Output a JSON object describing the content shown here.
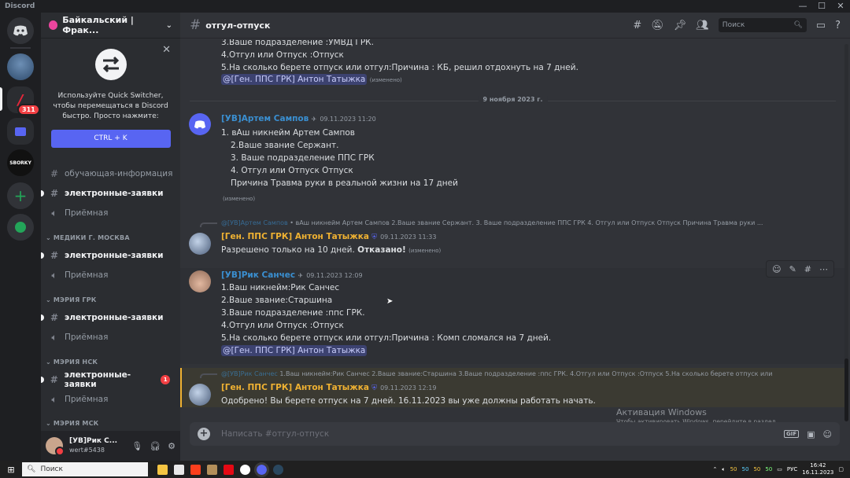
{
  "window": {
    "title": "Discord"
  },
  "server_badge_count": "311",
  "guild": {
    "name": "Байкальский | Фрак..."
  },
  "quick_switcher": {
    "text": "Используйте Quick Switcher, чтобы перемещаться в Discord быстро. Просто нажмите:",
    "shortcut": "CTRL + K"
  },
  "sidebar": {
    "channels": [
      {
        "name": "обучающая-информация",
        "type": "text"
      },
      {
        "name": "электронные-заявки",
        "type": "text"
      },
      {
        "name": "Приёмная",
        "type": "voice"
      }
    ],
    "categories": [
      {
        "name": "МЕДИКИ Г. МОСКВА",
        "channels": [
          {
            "name": "электронные-заявки"
          },
          {
            "name": "Приёмная"
          }
        ]
      },
      {
        "name": "МЭРИЯ ГРК",
        "channels": [
          {
            "name": "электронные-заявки"
          },
          {
            "name": "Приёмная"
          }
        ]
      },
      {
        "name": "МЭРИЯ НСК",
        "channels": [
          {
            "name": "электронные-заявки",
            "badge": "1"
          },
          {
            "name": "Приёмная"
          }
        ]
      },
      {
        "name": "МЭРИЯ МСК"
      }
    ]
  },
  "user": {
    "name": "[УВ]Рик С...",
    "tag": "wert#5438"
  },
  "channel": {
    "name": "отгул-отпуск"
  },
  "search": {
    "placeholder": "Поиск"
  },
  "messages": {
    "top_lines": [
      "3.Ваше подразделение :УМВД ГРК.",
      "4.Отгул или Отпуск :Отпуск",
      "5.На сколько берете отпуск или отгул:Причина :  КБ, решил отдохнуть на 7 дней."
    ],
    "top_mention": "@[Ген. ППС ГРК] Антон Татыжка",
    "edited": "(изменено)",
    "date_divider": "9 ноября 2023 г.",
    "m1": {
      "author": "[УВ]Артем Сампов",
      "time": "09.11.2023 11:20",
      "lines": [
        "1. вАш никнейм Артем Сампов",
        "   2.Ваше звание Сержант.",
        "   3. Ваше подразделение ППС ГРК",
        "   4. Отгул или Отпуск Отпуск",
        "   Причина Травма руки в реальной жизни на  17 дней"
      ]
    },
    "m2": {
      "reply_author": "@[УВ]Артем Сампов",
      "reply_text": "• вАш никнейм Артем Сампов 2.Ваше звание Сержант. 3. Ваше подразделение ППС ГРК 4. Отгул или Отпуск Отпуск Причина Травма руки ...",
      "author": "[Ген. ППС ГРК] Антон Татыжка",
      "time": "09.11.2023 11:33",
      "text": "Разрешено только на 10 дней.",
      "bold": "Отказано!"
    },
    "m3": {
      "author": "[УВ]Рик Санчес",
      "time": "09.11.2023 12:09",
      "lines": [
        "1.Ваш никнейм:Рик Санчес",
        "2.Ваше звание:Старшина",
        "3.Ваше подразделение :ппс ГРК.",
        "4.Отгул или Отпуск :Отпуск",
        "5.На сколько берете отпуск или отгул:Причина :  Комп  сломался на 7 дней."
      ],
      "mention": "@[Ген. ППС ГРК] Антон Татыжка"
    },
    "m4": {
      "reply_author": "@[УВ]Рик Санчес",
      "reply_text": "1.Ваш никнейм:Рик Санчес 2.Ваше звание:Старшина 3.Ваше подразделение :ппс ГРК. 4.Отгул или Отпуск :Отпуск 5.На сколько берете отпуск или",
      "author": "[Ген. ППС ГРК] Антон Татыжка",
      "time": "09.11.2023 12:19",
      "text": "Одобрено!  Вы берете отпуск на 7 дней.  16.11.2023 вы уже должны работать начать."
    }
  },
  "composer": {
    "placeholder": "Написать #отгул-отпуск",
    "gif": "GIF"
  },
  "windows_activation": {
    "title": "Активация Windows",
    "subtitle": "Чтобы активировать Windows, перейдите в раздел"
  },
  "taskbar": {
    "search": "Поиск",
    "lang": "РУС",
    "time": "16:42",
    "date": "16.11.2023",
    "tray_numbers": [
      "50",
      "50",
      "50",
      "50"
    ]
  },
  "colors": {
    "blurple": "#5865f2",
    "author_blue": "#3a8fd1",
    "author_gold": "#f0b232",
    "mention_bg": "#3c4270",
    "highlight": "#3b3a32"
  }
}
